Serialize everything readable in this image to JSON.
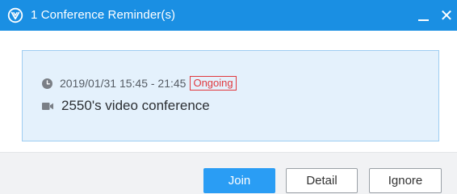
{
  "window": {
    "title": "1 Conference Reminder(s)",
    "accent_color": "#1a8fe3",
    "logo_icon": "v-circle-logo-icon",
    "minimize_icon": "minimize-icon",
    "close_icon": "close-icon",
    "close_glyph": "✕"
  },
  "reminder": {
    "time_icon": "clock-icon",
    "time_range": "2019/01/31 15:45 - 21:45",
    "status": "Ongoing",
    "status_color": "#e0393e",
    "subject_icon": "video-camera-icon",
    "subject": "2550's video conference"
  },
  "actions": {
    "join_label": "Join",
    "detail_label": "Detail",
    "ignore_label": "Ignore"
  }
}
